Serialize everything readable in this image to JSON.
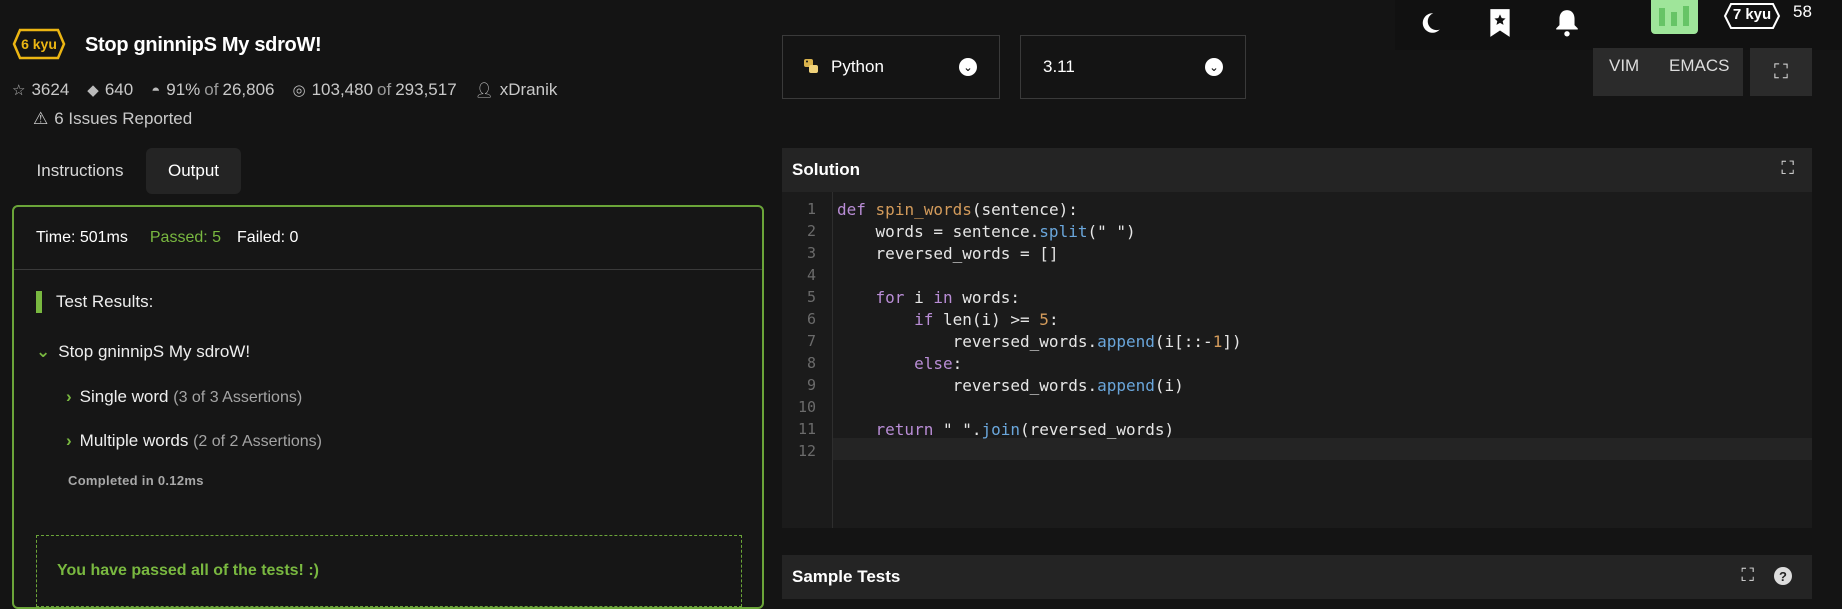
{
  "topbar": {
    "icons": [
      "moon-icon",
      "bookmark-icon",
      "bell-icon"
    ],
    "rank": "7 kyu",
    "score": "58"
  },
  "kata": {
    "rank": "6 kyu",
    "title": "Stop gninnipS My sdroW!",
    "stats": {
      "stars": "3624",
      "collections": "640",
      "satisfaction_pct": "91%",
      "satisfaction_of": "of",
      "satisfaction_total": "26,806",
      "completed": "103,480",
      "completed_of": "of",
      "attempted": "293,517",
      "author": "xDranik"
    },
    "issues": "6 Issues Reported"
  },
  "tabs": {
    "instructions": "Instructions",
    "output": "Output"
  },
  "output": {
    "time": "Time: 501ms",
    "passed": "Passed: 5",
    "failed": "Failed: 0",
    "results_title": "Test Results:",
    "group": "Stop gninnipS My sdroW!",
    "tests": [
      {
        "name": "Single word",
        "detail": "(3 of 3 Assertions)"
      },
      {
        "name": "Multiple words",
        "detail": "(2 of 2 Assertions)"
      }
    ],
    "completed": "Completed in 0.12ms",
    "pass_message": "You have passed all of the tests! :)"
  },
  "language": {
    "selected": "Python"
  },
  "version": {
    "selected": "3.11"
  },
  "editor_modes": {
    "vim": "VIM",
    "emacs": "EMACS"
  },
  "solution": {
    "title": "Solution",
    "line_numbers": [
      "1",
      "2",
      "3",
      "4",
      "5",
      "6",
      "7",
      "8",
      "9",
      "10",
      "11",
      "12"
    ]
  },
  "sample_tests": {
    "title": "Sample Tests"
  },
  "colors": {
    "accent_green": "#79b840",
    "kyu_yellow": "#ecb613",
    "code_keyword": "#b98dd6",
    "code_function": "#d39b5b",
    "code_method": "#6aa6db"
  }
}
